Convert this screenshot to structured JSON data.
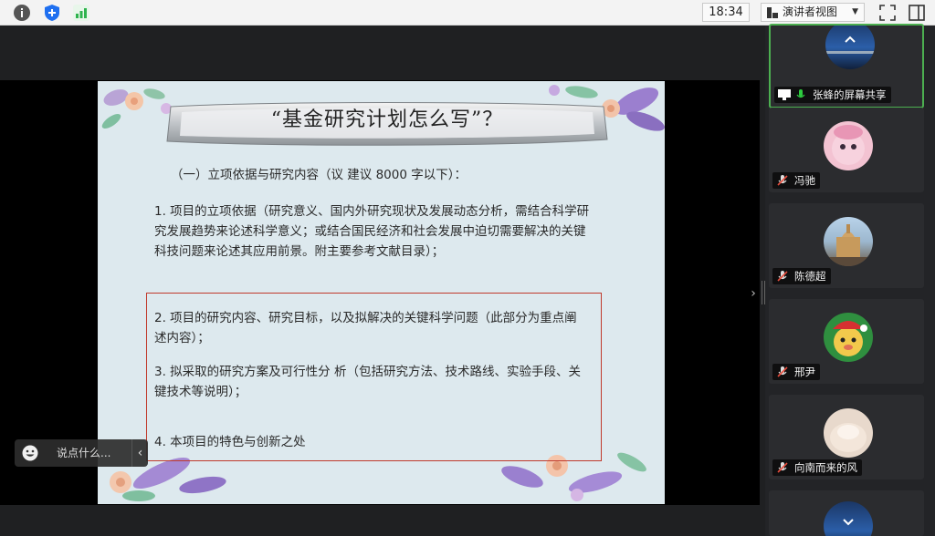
{
  "toolbar": {
    "time": "18:34",
    "view_mode": "演讲者视图"
  },
  "slide": {
    "title": "“基金研究计划怎么写”？",
    "subtitle": "（一）立项依据与研究内容（议 建议 8000 字以下）：",
    "item1": "1.  项目的立项依据（研究意义、国内外研究现状及发展动态分析，需结合科学研究发展趋势来论述科学意义；或结合国民经济和社会发展中迫切需要解决的关键科技问题来论述其应用前景。附主要参考文献目录）；",
    "item2": "2.  项目的研究内容、研究目标，以及拟解决的关键科学问题（此部分为重点阐述内容）；",
    "item3": "3.  拟采取的研究方案及可行性分 析（包括研究方法、技术路线、实验手段、关键技术等说明）；",
    "item4": "4. 本项目的特色与创新之处"
  },
  "chat": {
    "placeholder": "说点什么..."
  },
  "participants": [
    {
      "name": "张蜂的屏幕共享",
      "active": true
    },
    {
      "name": "冯驰",
      "muted": true
    },
    {
      "name": "陈德超",
      "muted": true
    },
    {
      "name": "邢尹",
      "muted": true
    },
    {
      "name": "向南而来的风",
      "muted": true
    }
  ],
  "colors": {
    "active_border": "#4caf50",
    "highlight_box": "#c0392b",
    "slide_bg": "#dde9ee"
  }
}
